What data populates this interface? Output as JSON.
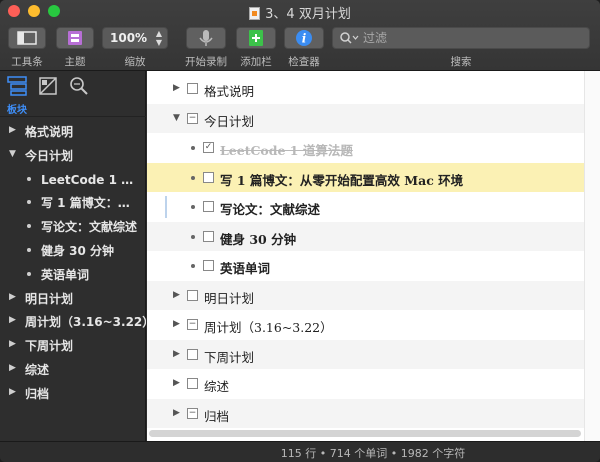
{
  "window": {
    "title": "3、4 双月计划"
  },
  "toolbar": {
    "toolbar_label": "工具条",
    "theme_label": "主题",
    "zoom_value": "100%",
    "zoom_label": "缩放",
    "record_label": "开始录制",
    "addbar_label": "添加栏",
    "inspector_label": "检查器",
    "search_placeholder": "过滤",
    "search_label": "搜索"
  },
  "sidebar": {
    "caption": "板块",
    "items": [
      {
        "label": "格式说明",
        "expanded": false,
        "level": 0
      },
      {
        "label": "今日计划",
        "expanded": true,
        "level": 0
      },
      {
        "label": "LeetCode 1 道算法题",
        "level": 1
      },
      {
        "label": "写 1 篇博文：从零开始配置高效 Mac 环境",
        "level": 1
      },
      {
        "label": "写论文：文献综述",
        "level": 1
      },
      {
        "label": "健身 30 分钟",
        "level": 1
      },
      {
        "label": "英语单词",
        "level": 1
      },
      {
        "label": "明日计划",
        "expanded": false,
        "level": 0
      },
      {
        "label": "周计划（3.16~3.22）",
        "expanded": false,
        "level": 0
      },
      {
        "label": "下周计划",
        "expanded": false,
        "level": 0
      },
      {
        "label": "综述",
        "expanded": false,
        "level": 0
      },
      {
        "label": "归档",
        "expanded": false,
        "level": 0
      }
    ]
  },
  "outline": {
    "rows": [
      {
        "text": "格式说明",
        "type": "collapsed",
        "box": ""
      },
      {
        "text": "今日计划",
        "type": "expanded",
        "box": "−"
      },
      {
        "text": "LeetCode 1 道算法题",
        "type": "child",
        "box": "✓",
        "done": true
      },
      {
        "text": "写 1 篇博文：从零开始配置高效 Mac 环境",
        "type": "child",
        "box": "",
        "highlight": true
      },
      {
        "text": "写论文：文献综述",
        "type": "child",
        "box": ""
      },
      {
        "text": "健身 30 分钟",
        "type": "child",
        "box": ""
      },
      {
        "text": "英语单词",
        "type": "child",
        "box": ""
      },
      {
        "text": "明日计划",
        "type": "collapsed",
        "box": ""
      },
      {
        "text": "周计划（3.16~3.22）",
        "type": "collapsed",
        "box": "−"
      },
      {
        "text": "下周计划",
        "type": "collapsed",
        "box": ""
      },
      {
        "text": "综述",
        "type": "collapsed",
        "box": ""
      },
      {
        "text": "归档",
        "type": "collapsed",
        "box": "−"
      }
    ]
  },
  "status": {
    "text": "115 行 • 714 个单词 • 1982 个字符"
  },
  "colors": {
    "accent": "#3e8ef7",
    "highlight": "#fbf1b4",
    "theme_icon": "#b86fd6",
    "addbar_icon": "#3cc24a",
    "inspector_icon": "#3b8df2"
  }
}
